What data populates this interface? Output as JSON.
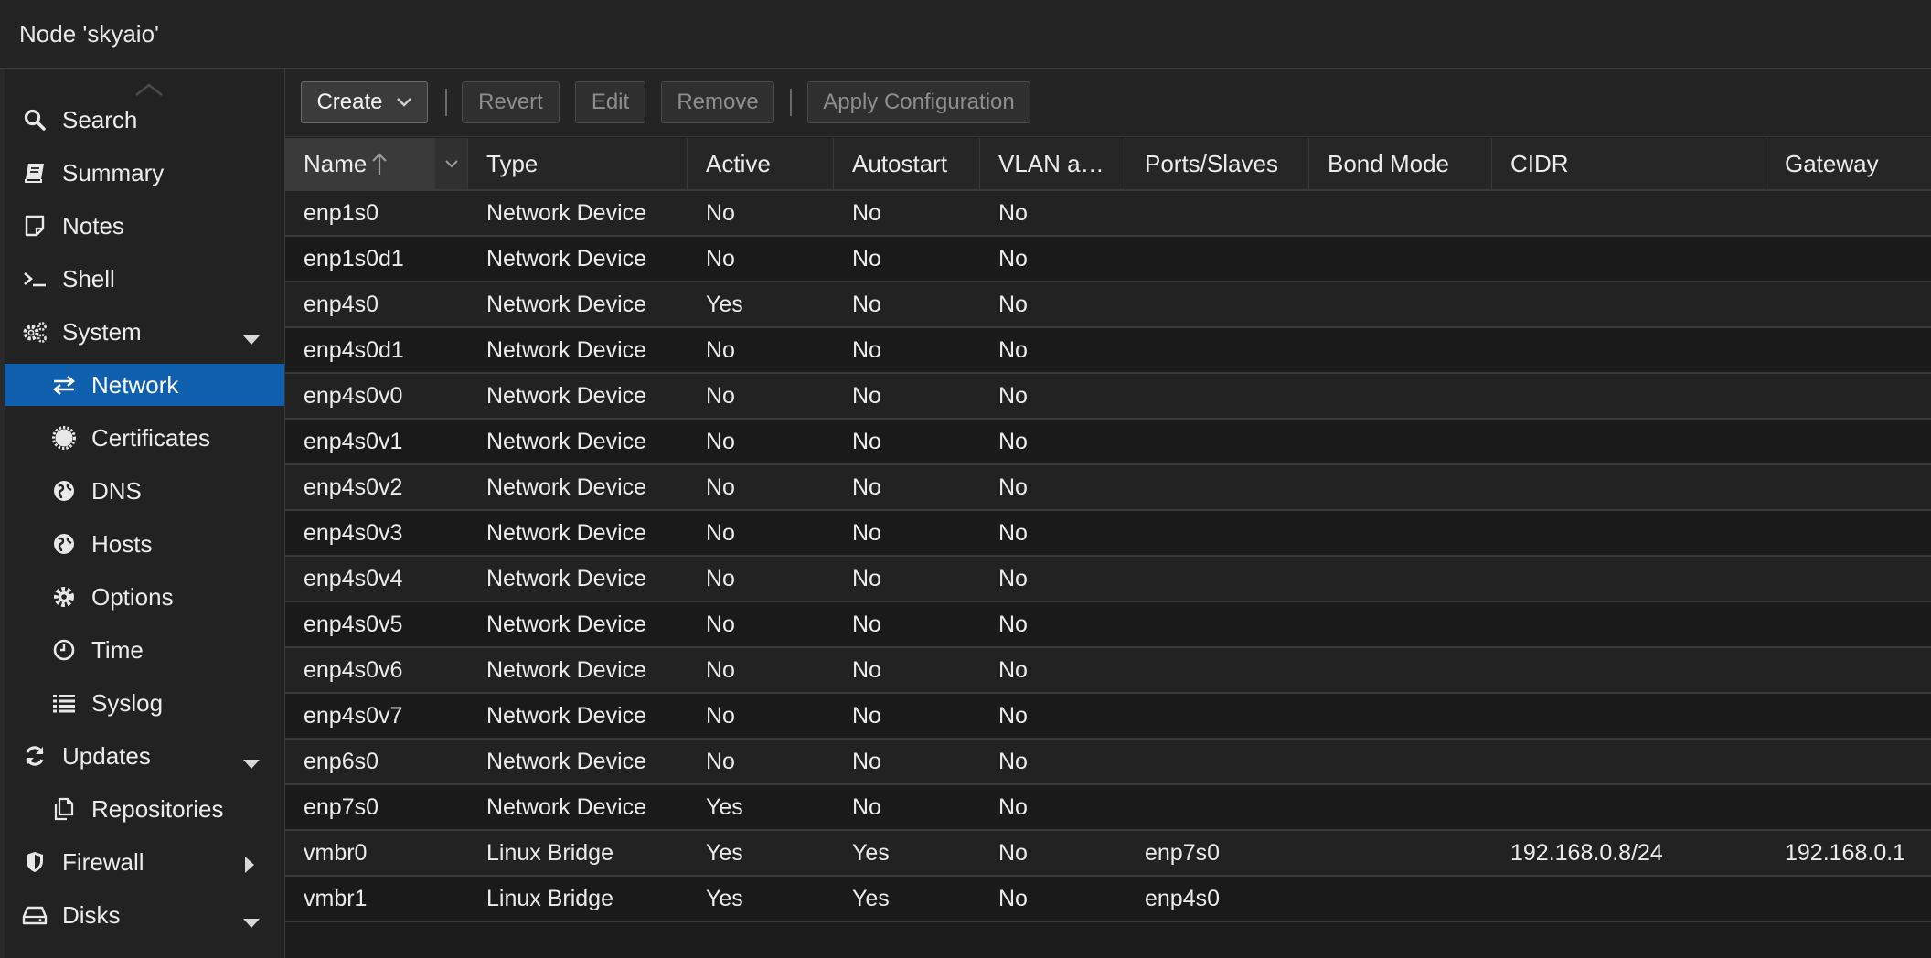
{
  "header": {
    "title": "Node 'skyaio'"
  },
  "sidebar": {
    "items": [
      {
        "label": "Search",
        "icon": "search-icon"
      },
      {
        "label": "Summary",
        "icon": "book-icon"
      },
      {
        "label": "Notes",
        "icon": "note-icon"
      },
      {
        "label": "Shell",
        "icon": "terminal-icon"
      },
      {
        "label": "System",
        "icon": "gears-icon",
        "expanded": true
      },
      {
        "label": "Network",
        "icon": "exchange-icon",
        "active": true
      },
      {
        "label": "Certificates",
        "icon": "certificate-icon"
      },
      {
        "label": "DNS",
        "icon": "globe-icon"
      },
      {
        "label": "Hosts",
        "icon": "globe-icon"
      },
      {
        "label": "Options",
        "icon": "gear-icon"
      },
      {
        "label": "Time",
        "icon": "clock-icon"
      },
      {
        "label": "Syslog",
        "icon": "list-icon"
      },
      {
        "label": "Updates",
        "icon": "refresh-icon",
        "expanded": true
      },
      {
        "label": "Repositories",
        "icon": "files-icon"
      },
      {
        "label": "Firewall",
        "icon": "shield-icon",
        "expanded": false
      },
      {
        "label": "Disks",
        "icon": "hdd-icon",
        "expanded": true
      }
    ]
  },
  "toolbar": {
    "create_label": "Create",
    "revert_label": "Revert",
    "edit_label": "Edit",
    "remove_label": "Remove",
    "apply_label": "Apply Configuration"
  },
  "table": {
    "columns": [
      "Name",
      "Type",
      "Active",
      "Autostart",
      "VLAN a…",
      "Ports/Slaves",
      "Bond Mode",
      "CIDR",
      "Gateway"
    ],
    "rows": [
      [
        "enp1s0",
        "Network Device",
        "No",
        "No",
        "No",
        "",
        "",
        "",
        ""
      ],
      [
        "enp1s0d1",
        "Network Device",
        "No",
        "No",
        "No",
        "",
        "",
        "",
        ""
      ],
      [
        "enp4s0",
        "Network Device",
        "Yes",
        "No",
        "No",
        "",
        "",
        "",
        ""
      ],
      [
        "enp4s0d1",
        "Network Device",
        "No",
        "No",
        "No",
        "",
        "",
        "",
        ""
      ],
      [
        "enp4s0v0",
        "Network Device",
        "No",
        "No",
        "No",
        "",
        "",
        "",
        ""
      ],
      [
        "enp4s0v1",
        "Network Device",
        "No",
        "No",
        "No",
        "",
        "",
        "",
        ""
      ],
      [
        "enp4s0v2",
        "Network Device",
        "No",
        "No",
        "No",
        "",
        "",
        "",
        ""
      ],
      [
        "enp4s0v3",
        "Network Device",
        "No",
        "No",
        "No",
        "",
        "",
        "",
        ""
      ],
      [
        "enp4s0v4",
        "Network Device",
        "No",
        "No",
        "No",
        "",
        "",
        "",
        ""
      ],
      [
        "enp4s0v5",
        "Network Device",
        "No",
        "No",
        "No",
        "",
        "",
        "",
        ""
      ],
      [
        "enp4s0v6",
        "Network Device",
        "No",
        "No",
        "No",
        "",
        "",
        "",
        ""
      ],
      [
        "enp4s0v7",
        "Network Device",
        "No",
        "No",
        "No",
        "",
        "",
        "",
        ""
      ],
      [
        "enp6s0",
        "Network Device",
        "No",
        "No",
        "No",
        "",
        "",
        "",
        ""
      ],
      [
        "enp7s0",
        "Network Device",
        "Yes",
        "No",
        "No",
        "",
        "",
        "",
        ""
      ],
      [
        "vmbr0",
        "Linux Bridge",
        "Yes",
        "Yes",
        "No",
        "enp7s0",
        "",
        "192.168.0.8/24",
        "192.168.0.1"
      ],
      [
        "vmbr1",
        "Linux Bridge",
        "Yes",
        "Yes",
        "No",
        "enp4s0",
        "",
        "",
        ""
      ]
    ]
  },
  "colors": {
    "active_nav": "#0e5fae",
    "background": "#1c1c1c",
    "panel": "#242424"
  }
}
